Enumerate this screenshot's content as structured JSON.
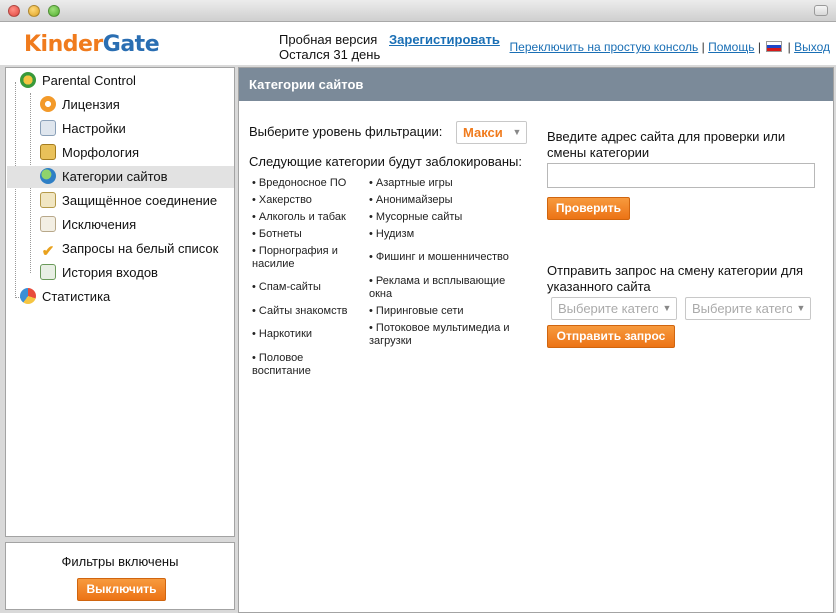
{
  "window": {
    "title": ""
  },
  "header": {
    "logo_part1": "Kinder",
    "logo_part2": "Gate",
    "trial_line1": "Пробная версия",
    "trial_line2": "Остался 31 день",
    "register": "Зарегистировать",
    "switch_console": "Переключить на простую консоль",
    "help": "Помощь",
    "logout": "Выход",
    "separator": "|"
  },
  "sidebar": {
    "root": "Parental Control",
    "items": [
      {
        "label": "Лицензия",
        "icon": "license-icon"
      },
      {
        "label": "Настройки",
        "icon": "settings-icon"
      },
      {
        "label": "Морфология",
        "icon": "morphology-icon"
      },
      {
        "label": "Категории сайтов",
        "icon": "site-categories-icon",
        "selected": true
      },
      {
        "label": "Защищённое соединение",
        "icon": "secure-connection-icon"
      },
      {
        "label": "Исключения",
        "icon": "exceptions-icon"
      },
      {
        "label": "Запросы на белый список",
        "icon": "whitelist-requests-icon"
      },
      {
        "label": "История входов",
        "icon": "login-history-icon"
      }
    ],
    "statistics": "Статистика"
  },
  "status": {
    "filters_on": "Фильтры включены",
    "turn_off": "Выключить"
  },
  "main": {
    "title": "Категории сайтов",
    "level_label": "Выберите уровень фильтрации:",
    "level_value": "Макси",
    "blocked_label": "Следующие категории будут заблокированы:",
    "categories_col1": [
      "• Вредоносное ПО",
      "• Хакерство",
      "• Алкоголь и табак",
      "• Ботнеты",
      "• Порнография и насилие",
      "• Спам-сайты",
      "• Сайты знакомств",
      "• Наркотики",
      "• Половое воспитание"
    ],
    "categories_col2": [
      "• Азартные игры",
      "• Анонимайзеры",
      "• Мусорные сайты",
      "• Нудизм",
      "• Фишинг и мошенничество",
      "• Реклама и всплывающие окна",
      "• Пиринговые сети",
      "• Потоковое мультимедиа и загрузки"
    ],
    "check_label": "Введите адрес сайта для проверки или смены категории",
    "url_value": "",
    "check_button": "Проверить",
    "send_label": "Отправить запрос на смену категории для указанного сайта",
    "category_select_1": "Выберите категорию",
    "category_select_2": "Выберите категорию",
    "send_button": "Отправить запрос"
  },
  "colors": {
    "accent_orange": "#f07b1d",
    "brand_blue": "#2a6eb2",
    "panel_header": "#7b8a99",
    "link": "#1a6fb5"
  }
}
